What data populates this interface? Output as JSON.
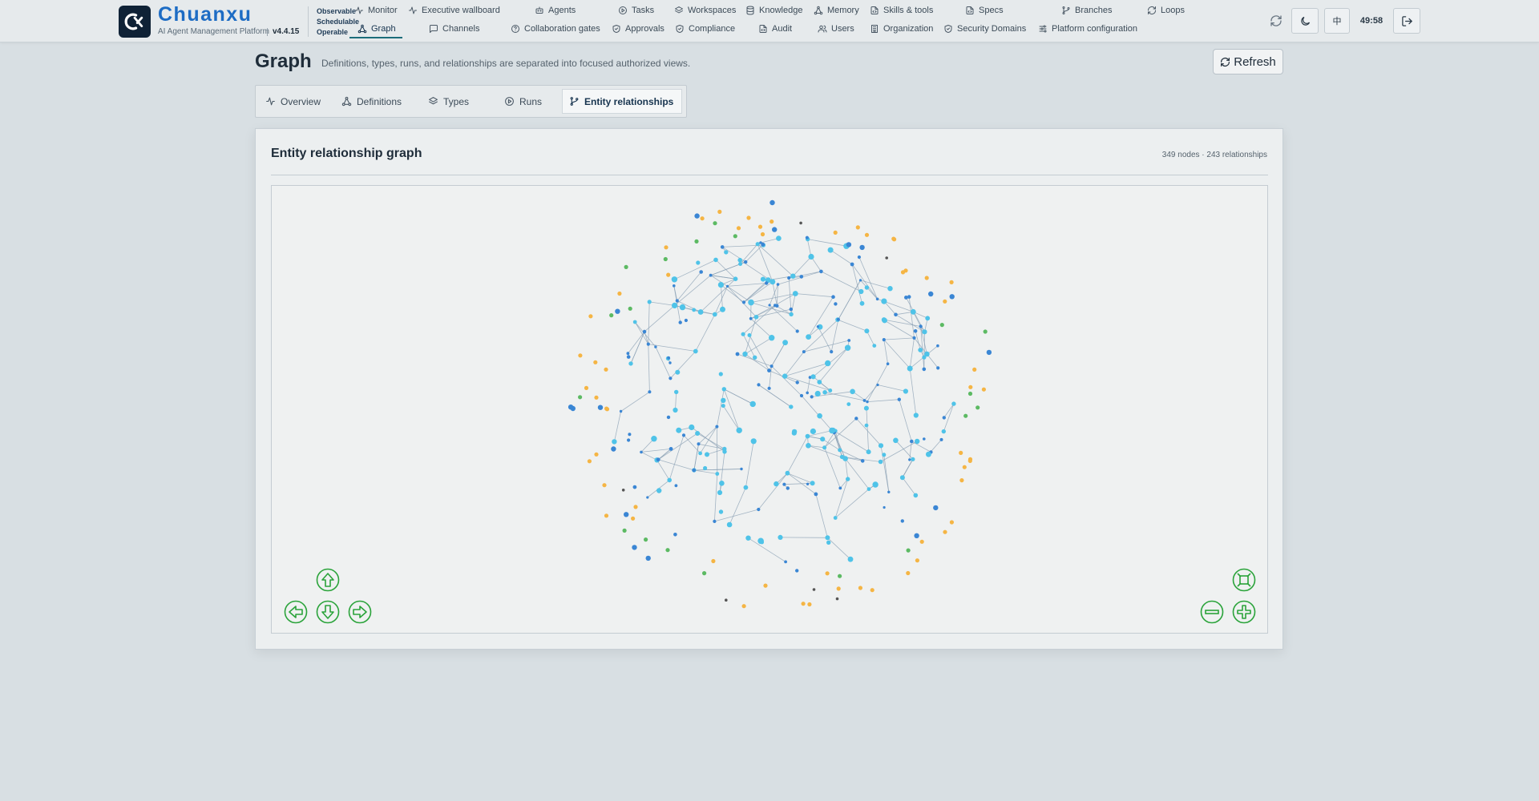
{
  "app": {
    "name": "Chuanxu",
    "subtitle": "AI Agent Management Platform",
    "version": "v4.4.15",
    "tagline": [
      "Observable",
      "Schedulable",
      "Operable"
    ]
  },
  "nav": {
    "row1": [
      {
        "label": "Monitor",
        "icon": "pulse-icon"
      },
      {
        "label": "Executive wallboard",
        "icon": "pulse-icon"
      },
      {
        "label": "Agents",
        "icon": "robot-icon"
      },
      {
        "label": "Tasks",
        "icon": "play-circle-icon"
      },
      {
        "label": "Workspaces",
        "icon": "layers-icon"
      },
      {
        "label": "Knowledge",
        "icon": "database-icon"
      },
      {
        "label": "Memory",
        "icon": "graph-icon"
      },
      {
        "label": "Skills & tools",
        "icon": "file-code-icon"
      },
      {
        "label": "Specs",
        "icon": "file-code-icon"
      },
      {
        "label": "Branches",
        "icon": "branch-icon"
      },
      {
        "label": "Loops",
        "icon": "loop-icon"
      }
    ],
    "row2": [
      {
        "label": "Graph",
        "icon": "graph-icon",
        "active": true
      },
      {
        "label": "Channels",
        "icon": "chat-icon"
      },
      {
        "label": "Collaboration gates",
        "icon": "help-circle-icon"
      },
      {
        "label": "Approvals",
        "icon": "shield-check-icon"
      },
      {
        "label": "Compliance",
        "icon": "shield-check-icon"
      },
      {
        "label": "Audit",
        "icon": "file-code-icon"
      },
      {
        "label": "Users",
        "icon": "users-icon"
      },
      {
        "label": "Organization",
        "icon": "building-icon"
      },
      {
        "label": "Security Domains",
        "icon": "shield-check-icon"
      },
      {
        "label": "Platform configuration",
        "icon": "sliders-icon"
      }
    ]
  },
  "header_actions": {
    "language": "中",
    "timer": "49:58"
  },
  "page": {
    "title": "Graph",
    "description": "Definitions, types, runs, and relationships are separated into focused authorized views.",
    "refresh_label": "Refresh"
  },
  "tabs": [
    {
      "label": "Overview",
      "icon": "pulse-icon"
    },
    {
      "label": "Definitions",
      "icon": "graph-icon"
    },
    {
      "label": "Types",
      "icon": "layers-icon"
    },
    {
      "label": "Runs",
      "icon": "play-circle-icon"
    },
    {
      "label": "Entity relationships",
      "icon": "branch-icon",
      "active": true
    }
  ],
  "graph": {
    "title": "Entity relationship graph",
    "stats": "349 nodes · 243 relationships",
    "node_count": 349,
    "relationship_count": 243,
    "colors": {
      "primary": "#4fc3e8",
      "secondary": "#3a86d4",
      "tertiary": "#f5b544",
      "quaternary": "#5cba63",
      "other": "#555555",
      "edge": "#8aa0b4"
    },
    "controls": [
      "arrow-up-icon",
      "arrow-left-icon",
      "arrow-down-icon",
      "arrow-right-icon",
      "fit-view-icon",
      "zoom-out-icon",
      "zoom-in-icon"
    ]
  }
}
